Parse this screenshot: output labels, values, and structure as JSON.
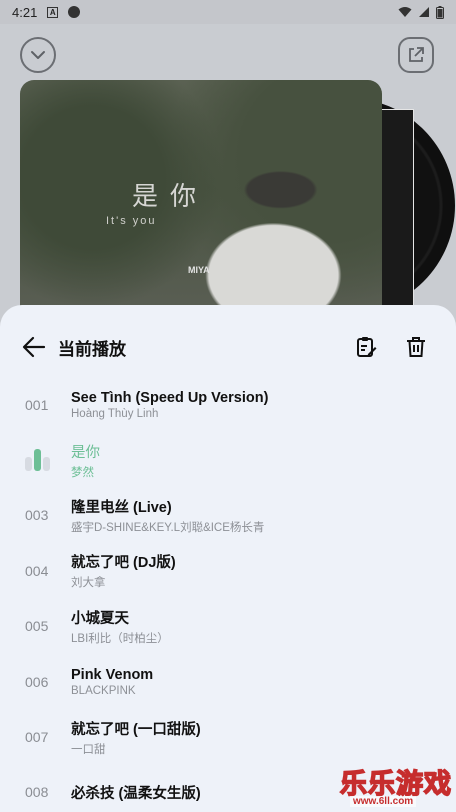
{
  "status_bar": {
    "time": "4:21",
    "a_label": "A"
  },
  "album": {
    "title_art": "是你",
    "subtitle_art": "It's  you",
    "artist_art": "MIYA"
  },
  "sheet": {
    "title": "当前播放",
    "tracks": [
      {
        "index": "001",
        "song": "See Tình (Speed Up Version)",
        "artist": "Hoàng Thùy Linh"
      },
      {
        "index": "",
        "song": "是你",
        "artist": "梦然",
        "playing": true
      },
      {
        "index": "003",
        "song": "隆里电丝 (Live)",
        "artist": "盛宇D-SHINE&KEY.L刘聪&ICE杨长青"
      },
      {
        "index": "004",
        "song": "就忘了吧 (DJ版)",
        "artist": "刘大拿"
      },
      {
        "index": "005",
        "song": "小城夏天",
        "artist": "LBI利比（时柏尘）"
      },
      {
        "index": "006",
        "song": "Pink Venom",
        "artist": "BLACKPINK"
      },
      {
        "index": "007",
        "song": "就忘了吧 (一口甜版)",
        "artist": "一口甜"
      },
      {
        "index": "008",
        "song": "必杀技 (温柔女生版)",
        "artist": ""
      }
    ],
    "playing_color": "#6dbf96"
  },
  "watermark": {
    "text": "乐乐游戏",
    "url": "www.6ll.com"
  }
}
